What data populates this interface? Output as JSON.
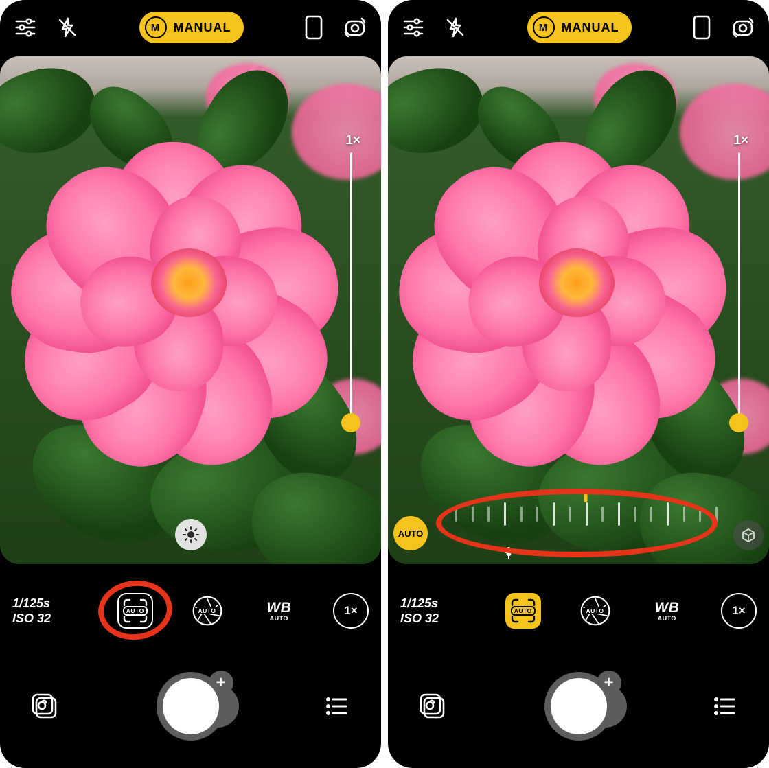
{
  "mode": {
    "badge": "M",
    "label": "MANUAL"
  },
  "zoom": {
    "label": "1×"
  },
  "exposure": {
    "shutter": "1/125s",
    "iso": "ISO 32"
  },
  "controls": {
    "focus_label": "AUTO",
    "aperture_label": "AUTO",
    "wb_label": "WB",
    "wb_sub": "AUTO",
    "zoom_label": "1×"
  },
  "focus_overlay": {
    "auto_label": "AUTO"
  },
  "shutter_plus": "+",
  "annotation": {
    "color": "#e6341a"
  }
}
